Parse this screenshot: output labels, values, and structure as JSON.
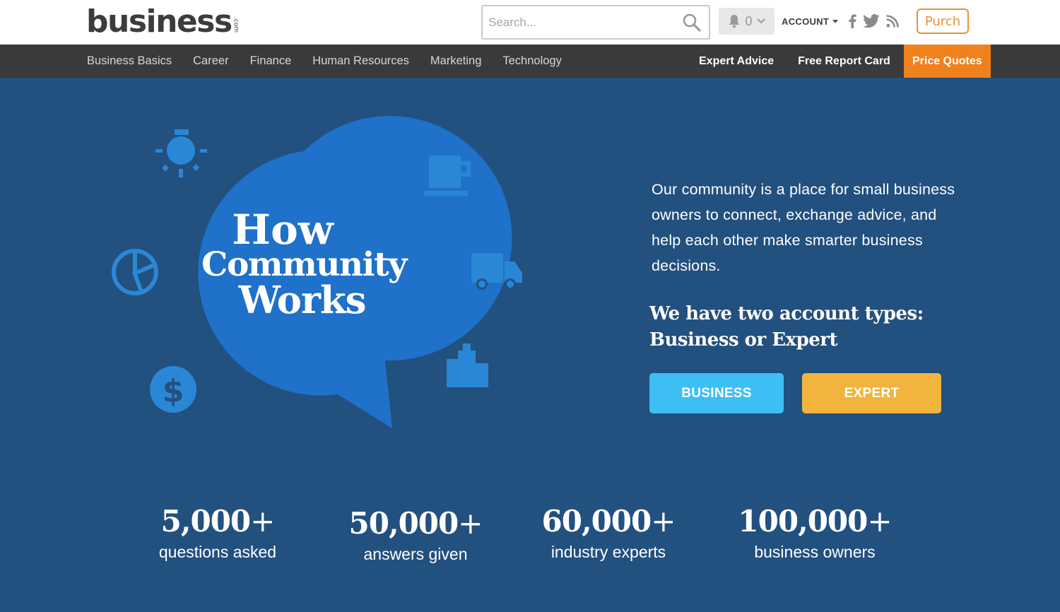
{
  "header": {
    "logo_word": "business",
    "logo_suffix": ".com",
    "search_placeholder": "Search...",
    "notification_count": "0",
    "account_label": "ACCOUNT",
    "partner_label": "Purch"
  },
  "nav": {
    "left": [
      "Business Basics",
      "Career",
      "Finance",
      "Human Resources",
      "Marketing",
      "Technology"
    ],
    "right": [
      "Expert Advice",
      "Free Report Card",
      "Price Quotes"
    ]
  },
  "hero": {
    "headline_1": "How",
    "headline_2": "Community",
    "headline_3": "Works",
    "intro": "Our community is a place for small business owners to connect, exchange advice, and help each other make smarter business decisions.",
    "account_types_1": "We have two account types:",
    "account_types_2": "Business or Expert",
    "business_button": "BUSINESS",
    "expert_button": "EXPERT"
  },
  "stats": [
    {
      "number": "5,000",
      "suffix": "+",
      "label": "questions asked"
    },
    {
      "number": "50,000",
      "suffix": "+",
      "label": "answers given"
    },
    {
      "number": "60,000",
      "suffix": "+",
      "label": "industry experts"
    },
    {
      "number": "100,000",
      "suffix": "+",
      "label": "business owners"
    }
  ],
  "colors": {
    "hero_bg": "#22507f",
    "bubble": "#1f71c9",
    "icon_blue": "#2a87d6",
    "nav_bg": "#3a3a3a",
    "price_quotes": "#f0821e",
    "business_button": "#3ebff3",
    "expert_button": "#f2b43d",
    "purch": "#e8923a"
  },
  "icons": [
    "search-icon",
    "bell-icon",
    "chevron-down-icon",
    "facebook-icon",
    "twitter-icon",
    "rss-icon",
    "lightbulb-icon",
    "coffee-cup-icon",
    "pie-chart-icon",
    "truck-icon",
    "dollar-icon",
    "building-icon"
  ]
}
